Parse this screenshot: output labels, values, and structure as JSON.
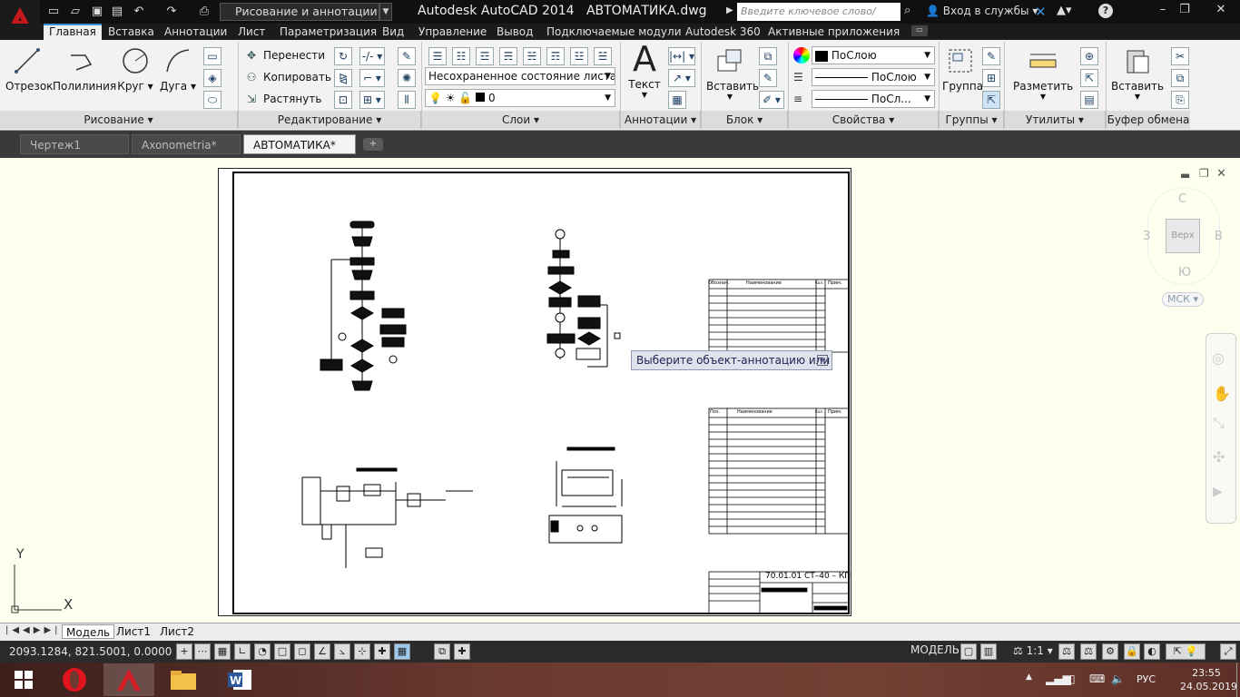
{
  "titlebar": {
    "workspace": "Рисование и аннотации",
    "app_name": "Autodesk AutoCAD 2014",
    "file_name": "АВТОМАТИКА.dwg",
    "search_placeholder": "Введите ключевое слово/фразу",
    "signin": "Вход в службы"
  },
  "ribbon_tabs": [
    "Главная",
    "Вставка",
    "Аннотации",
    "Лист",
    "Параметризация",
    "Вид",
    "Управление",
    "Вывод",
    "Подключаемые модули",
    "Autodesk 360",
    "Активные приложения"
  ],
  "panels": {
    "draw": {
      "title": "Рисование",
      "line": "Отрезок",
      "polyline": "Полилиния",
      "circle": "Круг",
      "arc": "Дуга"
    },
    "modify": {
      "title": "Редактирование",
      "move": "Перенести",
      "copy": "Копировать",
      "stretch": "Растянуть"
    },
    "layers": {
      "title": "Слои",
      "state": "Несохраненное состояние листа",
      "current": "0"
    },
    "annotation": {
      "title": "Аннотации",
      "text": "Текст"
    },
    "block": {
      "title": "Блок",
      "insert": "Вставить"
    },
    "properties": {
      "title": "Свойства",
      "color": "ПоСлою",
      "linetype": "ПоСлою",
      "lineweight": "ПоСл..."
    },
    "groups": {
      "title": "Группы",
      "group": "Группа"
    },
    "utilities": {
      "title": "Утилиты",
      "measure": "Разметить"
    },
    "clipboard": {
      "title": "Буфер обмена",
      "paste": "Вставить"
    }
  },
  "doc_tabs": [
    "Чертеж1",
    "Axonometria*",
    "АВТОМАТИКА*"
  ],
  "viewcube": {
    "top": "Верх",
    "north": "С",
    "south": "Ю",
    "west": "З",
    "east": "В",
    "wcs": "МСК"
  },
  "ucs": {
    "x": "X",
    "y": "Y"
  },
  "drawing": {
    "stamp": "70.01.01 СТ–40 – КП",
    "table1_headers": [
      "Обознач.",
      "Наименование",
      "Кол.",
      "Прим."
    ],
    "table2_headers": [
      "Поз.",
      "Наименование",
      "Кол.",
      "Прим."
    ]
  },
  "tooltip": "Выберите объект-аннотацию или",
  "layout_tabs": [
    "Модель",
    "Лист1",
    "Лист2"
  ],
  "status": {
    "coords": "2093.1284, 821.5001, 0.0000",
    "space": "МОДЕЛЬ",
    "scale": "1:1"
  },
  "taskbar": {
    "lang": "РУС",
    "time": "23:55",
    "date": "24.05.2019"
  },
  "colors": {
    "accent": "#3b8fd9",
    "autocad_red": "#c8161d",
    "drawing_bg": "#fffff0"
  }
}
